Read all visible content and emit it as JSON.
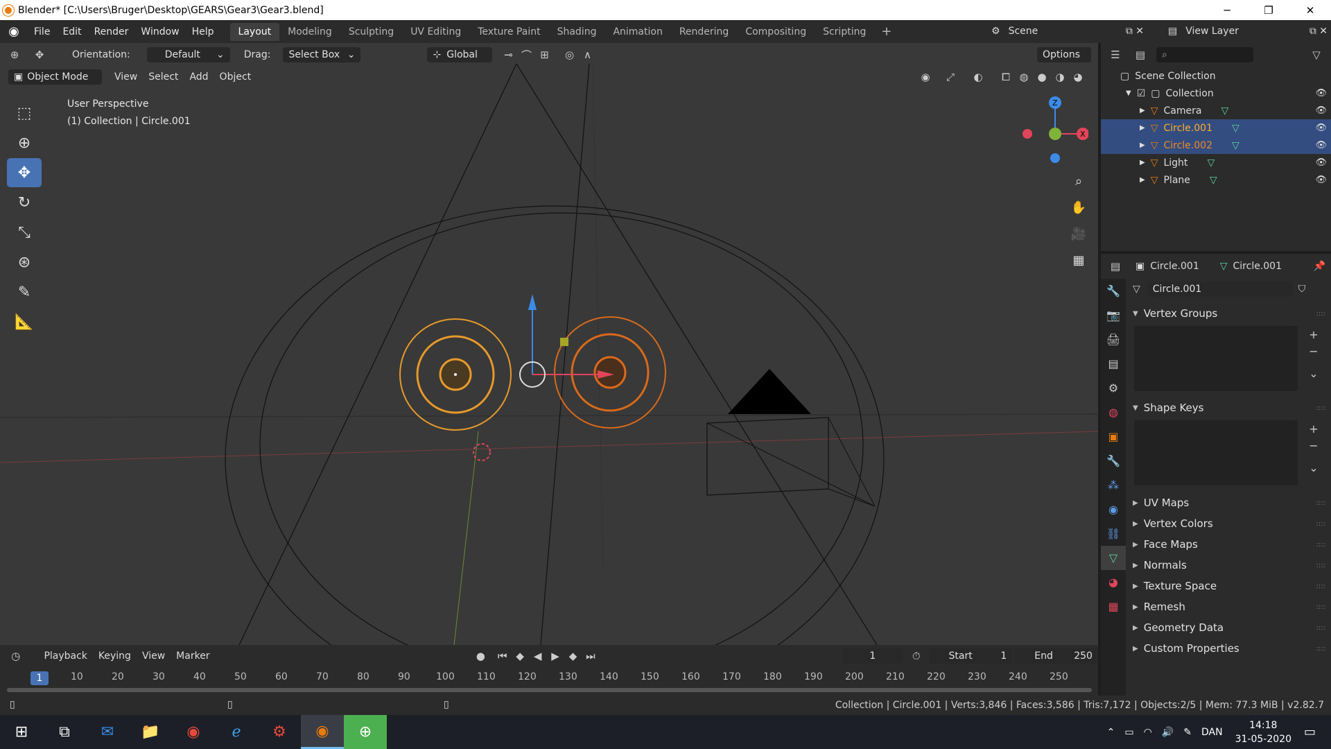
{
  "window": {
    "title": "Blender* [C:\\Users\\Bruger\\Desktop\\GEARS\\Gear3\\Gear3.blend]",
    "min": "─",
    "max": "❐",
    "close": "✕"
  },
  "menu": [
    "File",
    "Edit",
    "Render",
    "Window",
    "Help"
  ],
  "workspaces": [
    "Layout",
    "Modeling",
    "Sculpting",
    "UV Editing",
    "Texture Paint",
    "Shading",
    "Animation",
    "Rendering",
    "Compositing",
    "Scripting"
  ],
  "scene": {
    "label": "Scene"
  },
  "view_layer": {
    "label": "View Layer"
  },
  "header": {
    "orientation_label": "Orientation:",
    "orientation_value": "Default",
    "drag_label": "Drag:",
    "drag_value": "Select Box",
    "transform_orient": "Global",
    "options": "Options"
  },
  "header2": {
    "mode": "Object Mode",
    "items": [
      "View",
      "Select",
      "Add",
      "Object"
    ]
  },
  "viewport_info": {
    "line1": "User Perspective",
    "line2": "(1) Collection | Circle.001"
  },
  "gizmo": {
    "z": "Z",
    "x": "X"
  },
  "timeline": {
    "menus": [
      "Playback",
      "Keying",
      "View",
      "Marker"
    ],
    "current_frame": "1",
    "start_label": "Start",
    "start_value": "1",
    "end_label": "End",
    "end_value": "250",
    "ruler": [
      "1",
      "10",
      "20",
      "30",
      "40",
      "50",
      "60",
      "70",
      "80",
      "90",
      "100",
      "110",
      "120",
      "130",
      "140",
      "150",
      "160",
      "170",
      "180",
      "190",
      "200",
      "210",
      "220",
      "230",
      "240",
      "250"
    ]
  },
  "status": "Collection | Circle.001 | Verts:3,846 | Faces:3,586 | Tris:7,172 | Objects:2/5 | Mem: 77.3 MiB | v2.82.7",
  "outliner": {
    "root": "Scene Collection",
    "collection": "Collection",
    "items": [
      {
        "name": "Camera",
        "color": "#dddddd",
        "selected": false
      },
      {
        "name": "Circle.001",
        "color": "#ffaf29",
        "selected": true
      },
      {
        "name": "Circle.002",
        "color": "#f08a28",
        "selected": true
      },
      {
        "name": "Light",
        "color": "#dddddd",
        "selected": false
      },
      {
        "name": "Plane",
        "color": "#dddddd",
        "selected": false
      }
    ]
  },
  "properties": {
    "object_name": "Circle.001",
    "mesh_name": "Circle.001",
    "datablock": "Circle.001",
    "panels_open": [
      "Vertex Groups",
      "Shape Keys"
    ],
    "panels_closed": [
      "UV Maps",
      "Vertex Colors",
      "Face Maps",
      "Normals",
      "Texture Space",
      "Remesh",
      "Geometry Data",
      "Custom Properties"
    ]
  },
  "taskbar": {
    "lang": "DAN",
    "time": "14:18",
    "date": "31-05-2020"
  },
  "colors": {
    "accent": "#4772b3",
    "selected_orange": "#ffaf29",
    "gear_dark_orange": "#f08a28"
  }
}
